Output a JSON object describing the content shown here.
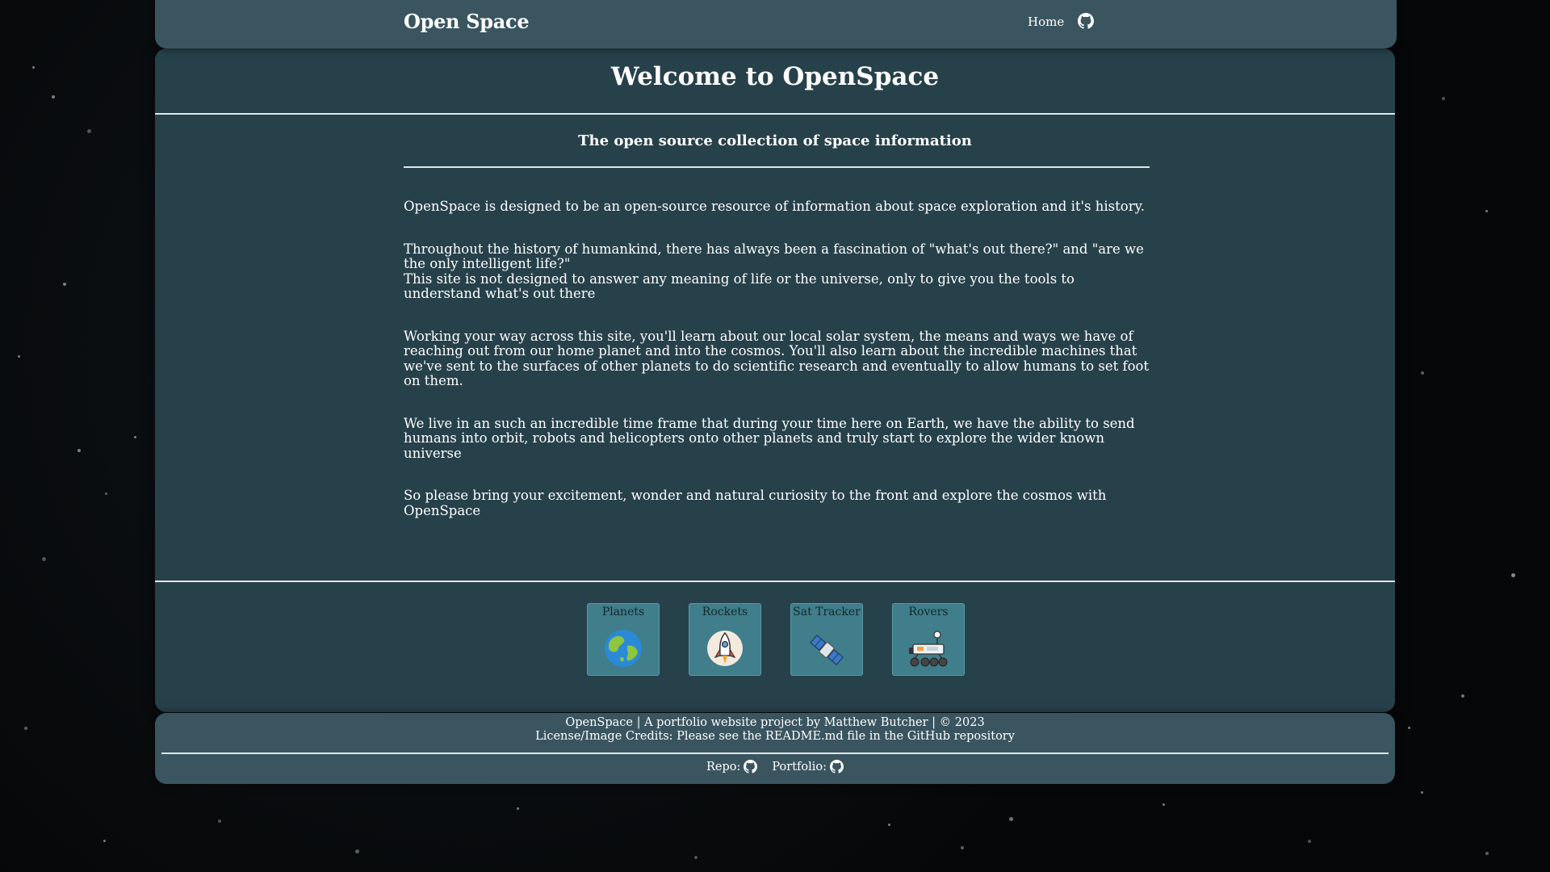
{
  "navbar": {
    "brand": "Open Space",
    "home_label": "Home",
    "github_icon": "github-icon"
  },
  "main": {
    "title": "Welcome to OpenSpace",
    "subtitle": "The open source collection of space information",
    "paragraphs": {
      "p1": "OpenSpace is designed to be an open-source resource of information about space exploration and it's history.",
      "p2a": "Throughout the history of humankind, there has always been a fascination of \"what's out there?\" and \"are we the only intelligent life?\"",
      "p2b": "This site is not designed to answer any meaning of life or the universe, only to give you the tools to understand what's out there",
      "p3": "Working your way across this site, you'll learn about our local solar system, the means and ways we have of reaching out from our home planet and into the cosmos. You'll also learn about the incredible machines that we've sent to the surfaces of other planets to do scientific research and eventually to allow humans to set foot on them.",
      "p4": "We live in an such an incredible time frame that during your time here on Earth, we have the ability to send humans into orbit, robots and helicopters onto other planets and truly start to explore the wider known universe",
      "p5": "So please bring your excitement, wonder and natural curiosity to the front and explore the cosmos with OpenSpace"
    },
    "cards": [
      {
        "label": "Planets",
        "icon": "earth-icon"
      },
      {
        "label": "Rockets",
        "icon": "rocket-icon"
      },
      {
        "label": "Sat Tracker",
        "icon": "satellite-icon"
      },
      {
        "label": "Rovers",
        "icon": "rover-icon"
      }
    ]
  },
  "footer": {
    "line1": "OpenSpace | A portfolio website project by Matthew Butcher | © 2023",
    "line2": "License/Image Credits: Please see the README.md file in the GitHub repository",
    "repo_label": "Repo:",
    "portfolio_label": "Portfolio:"
  },
  "colors": {
    "panel": "#27414b",
    "bar": "#3a5560",
    "card": "#3f7e8a",
    "background": "#060708"
  }
}
